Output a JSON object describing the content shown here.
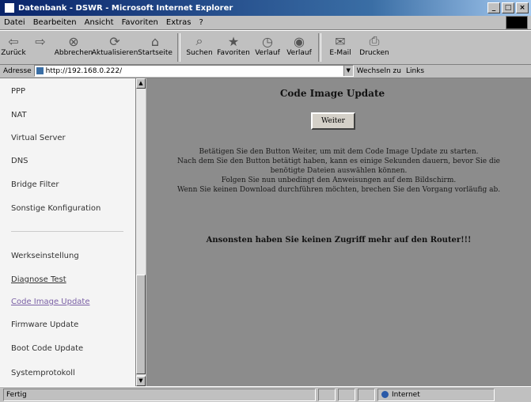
{
  "window": {
    "title": "Datenbank - DSWR - Microsoft Internet Explorer",
    "buttons": [
      "_",
      "□",
      "×"
    ]
  },
  "menubar": [
    "Datei",
    "Bearbeiten",
    "Ansicht",
    "Favoriten",
    "Extras",
    "?"
  ],
  "toolbar": [
    {
      "label": "Zurück",
      "icon": "back-arrow-icon",
      "glyph": "⇦"
    },
    {
      "label": "",
      "icon": "forward-arrow-icon",
      "glyph": "⇨"
    },
    {
      "label": "Abbrechen",
      "icon": "stop-icon",
      "glyph": "⊗"
    },
    {
      "label": "Aktualisieren",
      "icon": "refresh-icon",
      "glyph": "⟳"
    },
    {
      "label": "Startseite",
      "icon": "home-icon",
      "glyph": "⌂"
    },
    {
      "label": "Suchen",
      "icon": "search-icon",
      "glyph": "⌕"
    },
    {
      "label": "Favoriten",
      "icon": "favorites-icon",
      "glyph": "★"
    },
    {
      "label": "Verlauf",
      "icon": "history-icon",
      "glyph": "◷"
    },
    {
      "label": "Verlauf",
      "icon": "channels-icon",
      "glyph": "◉"
    },
    {
      "label": "E-Mail",
      "icon": "mail-icon",
      "glyph": "✉"
    },
    {
      "label": "Drucken",
      "icon": "print-icon",
      "glyph": "⎙"
    }
  ],
  "addressbar": {
    "label": "Adresse",
    "url": "http://192.168.0.222/",
    "go_label": "Wechseln zu",
    "links_label": "Links"
  },
  "sidebar": {
    "items": [
      {
        "label": "PPP",
        "style": "plain"
      },
      {
        "label": "NAT",
        "style": "plain"
      },
      {
        "label": "Virtual Server",
        "style": "plain"
      },
      {
        "label": "DNS",
        "style": "plain"
      },
      {
        "label": "Bridge Filter",
        "style": "plain"
      },
      {
        "label": "Sonstige Konfiguration",
        "style": "plain"
      },
      {
        "label": "Werkseinstellung",
        "style": "plain"
      },
      {
        "label": "Diagnose Test",
        "style": "link"
      },
      {
        "label": "Code Image Update",
        "style": "visited"
      },
      {
        "label": "Firmware Update",
        "style": "plain"
      },
      {
        "label": "Boot Code Update",
        "style": "plain"
      },
      {
        "label": "Systemprotokoll",
        "style": "plain"
      }
    ]
  },
  "content": {
    "title": "Code Image Update",
    "continue_label": "Weiter",
    "lines": [
      "Betätigen Sie den Button Weiter, um mit dem Code Image Update zu starten.",
      "Nach dem Sie den Button betätigt haben, kann es einige Sekunden dauern, bevor Sie die",
      "benötigte Dateien auswählen können.",
      "Folgen Sie nun unbedingt den Anweisungen auf dem Bildschirm.",
      "Wenn Sie keinen Download durchführen möchten, brechen Sie den Vorgang vorläufig ab."
    ],
    "warning": "Ansonsten haben Sie keinen Zugriff mehr auf den Router!!!"
  },
  "statusbar": {
    "status": "Fertig",
    "zone": "Internet"
  }
}
